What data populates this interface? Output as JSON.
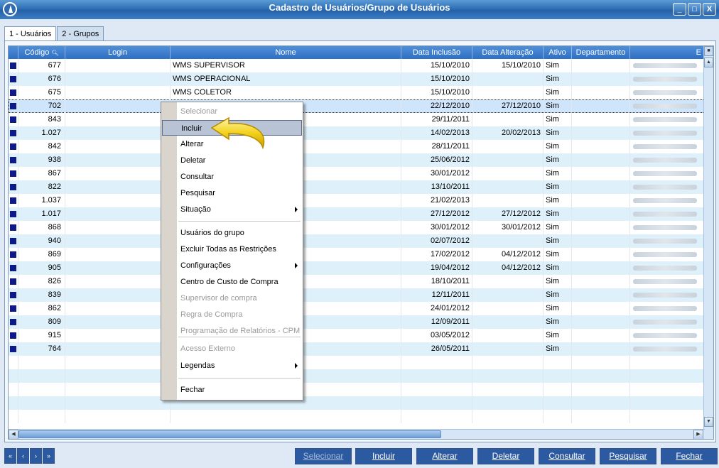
{
  "window": {
    "title": "Cadastro de Usuários/Grupo de Usuários",
    "controls": [
      "_",
      "□",
      "X"
    ]
  },
  "tabs": [
    {
      "key": "1",
      "label": "1 - Usuários"
    },
    {
      "key": "2",
      "label": "2 - Grupos"
    }
  ],
  "grid": {
    "columns": [
      "Código",
      "Login",
      "Nome",
      "Data Inclusão",
      "Data Alteração",
      "Ativo",
      "Departamento",
      "E"
    ],
    "rows": [
      {
        "codigo": "677",
        "nome": "WMS SUPERVISOR",
        "inclusao": "15/10/2010",
        "alteracao": "15/10/2010",
        "ativo": "Sim"
      },
      {
        "codigo": "676",
        "nome": "WMS OPERACIONAL",
        "inclusao": "15/10/2010",
        "alteracao": "",
        "ativo": "Sim"
      },
      {
        "codigo": "675",
        "nome": "WMS COLETOR",
        "inclusao": "15/10/2010",
        "alteracao": "",
        "ativo": "Sim"
      },
      {
        "codigo": "702",
        "nome": "",
        "inclusao": "22/12/2010",
        "alteracao": "27/12/2010",
        "ativo": "Sim"
      },
      {
        "codigo": "843",
        "nome": "",
        "inclusao": "29/11/2011",
        "alteracao": "",
        "ativo": "Sim"
      },
      {
        "codigo": "1.027",
        "nome": "",
        "inclusao": "14/02/2013",
        "alteracao": "20/02/2013",
        "ativo": "Sim"
      },
      {
        "codigo": "842",
        "nome": "",
        "inclusao": "28/11/2011",
        "alteracao": "",
        "ativo": "Sim"
      },
      {
        "codigo": "938",
        "nome": "",
        "inclusao": "25/06/2012",
        "alteracao": "",
        "ativo": "Sim"
      },
      {
        "codigo": "867",
        "nome": "",
        "inclusao": "30/01/2012",
        "alteracao": "",
        "ativo": "Sim"
      },
      {
        "codigo": "822",
        "nome": "",
        "inclusao": "13/10/2011",
        "alteracao": "",
        "ativo": "Sim"
      },
      {
        "codigo": "1.037",
        "nome": "",
        "inclusao": "21/02/2013",
        "alteracao": "",
        "ativo": "Sim"
      },
      {
        "codigo": "1.017",
        "nome": "",
        "inclusao": "27/12/2012",
        "alteracao": "27/12/2012",
        "ativo": "Sim"
      },
      {
        "codigo": "868",
        "nome": "",
        "inclusao": "30/01/2012",
        "alteracao": "30/01/2012",
        "ativo": "Sim"
      },
      {
        "codigo": "940",
        "nome": "",
        "inclusao": "02/07/2012",
        "alteracao": "",
        "ativo": "Sim"
      },
      {
        "codigo": "869",
        "nome": "",
        "inclusao": "17/02/2012",
        "alteracao": "04/12/2012",
        "ativo": "Sim"
      },
      {
        "codigo": "905",
        "nome": "",
        "inclusao": "19/04/2012",
        "alteracao": "04/12/2012",
        "ativo": "Sim"
      },
      {
        "codigo": "826",
        "nome": "",
        "inclusao": "18/10/2011",
        "alteracao": "",
        "ativo": "Sim"
      },
      {
        "codigo": "839",
        "nome": "",
        "inclusao": "12/11/2011",
        "alteracao": "",
        "ativo": "Sim"
      },
      {
        "codigo": "862",
        "nome": "",
        "inclusao": "24/01/2012",
        "alteracao": "",
        "ativo": "Sim"
      },
      {
        "codigo": "809",
        "nome": "",
        "inclusao": "12/09/2011",
        "alteracao": "",
        "ativo": "Sim"
      },
      {
        "codigo": "915",
        "nome": "",
        "inclusao": "03/05/2012",
        "alteracao": "",
        "ativo": "Sim"
      },
      {
        "codigo": "764",
        "nome": "",
        "inclusao": "26/05/2011",
        "alteracao": "",
        "ativo": "Sim"
      }
    ],
    "selected_codigo": "702"
  },
  "context_menu": {
    "items": [
      {
        "label": "Selecionar",
        "state": "disabled"
      },
      {
        "label": "Incluir",
        "state": "hover"
      },
      {
        "label": "Alterar",
        "state": "enabled"
      },
      {
        "label": "Deletar",
        "state": "enabled"
      },
      {
        "label": "Consultar",
        "state": "enabled"
      },
      {
        "label": "Pesquisar",
        "state": "enabled"
      },
      {
        "label": "Situação",
        "state": "enabled",
        "submenu": true
      },
      {
        "label": "Usuários do grupo",
        "state": "enabled"
      },
      {
        "label": "Excluir Todas as Restrições",
        "state": "enabled"
      },
      {
        "label": "Configurações",
        "state": "enabled",
        "submenu": true
      },
      {
        "label": "Centro de Custo de Compra",
        "state": "enabled"
      },
      {
        "label": "Supervisor de compra",
        "state": "disabled"
      },
      {
        "label": "Regra de Compra",
        "state": "disabled"
      },
      {
        "label": "Programação de Relatórios - CPM",
        "state": "disabled"
      },
      {
        "label": "Acesso Externo",
        "state": "disabled"
      },
      {
        "label": "Legendas",
        "state": "enabled",
        "submenu": true
      },
      {
        "label": "Fechar",
        "state": "enabled"
      }
    ]
  },
  "footer": {
    "nav": [
      "«",
      "‹",
      "›",
      "»"
    ],
    "actions": [
      {
        "label": "Selecionar",
        "enabled": false
      },
      {
        "label": "Incluir",
        "enabled": true
      },
      {
        "label": "Alterar",
        "enabled": true
      },
      {
        "label": "Deletar",
        "enabled": true
      },
      {
        "label": "Consultar",
        "enabled": true
      },
      {
        "label": "Pesquisar",
        "enabled": true
      },
      {
        "label": "Fechar",
        "enabled": true
      }
    ]
  },
  "colors": {
    "title_bar": "#2f6fb5",
    "header": "#3b7bd0",
    "row_alt": "#def1fb",
    "menu_hover": "#b8c3d6",
    "indicator": "#0c1a8a",
    "arrow": "#f2d21c"
  }
}
